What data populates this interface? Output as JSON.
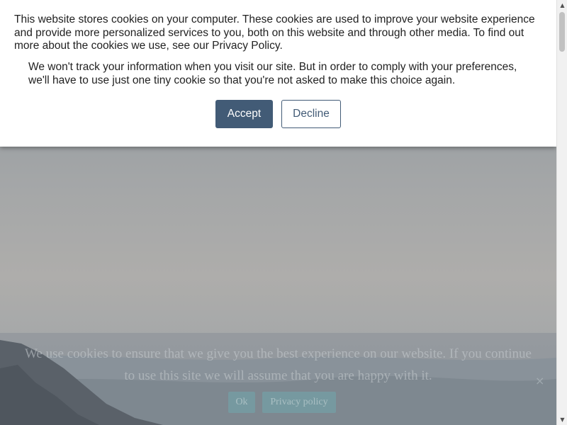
{
  "consent_banner": {
    "main_text": "This website stores cookies on your computer. These cookies are used to improve your website experience and provide more personalized services to you, both on this website and through other media. To find out more about the cookies we use, see our Privacy Policy.",
    "secondary_text": "We won't track your information when you visit our site. But in order to comply with your preferences, we'll have to use just one tiny cookie so that you're not asked to make this choice again.",
    "accept_label": "Accept",
    "decline_label": "Decline"
  },
  "site_cookie_bar": {
    "text": "We use cookies to ensure that we give you the best experience on our website. If you continue to use this site we will assume that you are happy with it.",
    "ok_label": "Ok",
    "privacy_label": "Privacy policy",
    "close_symbol": "×"
  },
  "scrollbar": {
    "up_arrow": "▲",
    "down_arrow": "▼"
  },
  "colors": {
    "accent": "#425b76",
    "banner_background": "#ffffff"
  }
}
